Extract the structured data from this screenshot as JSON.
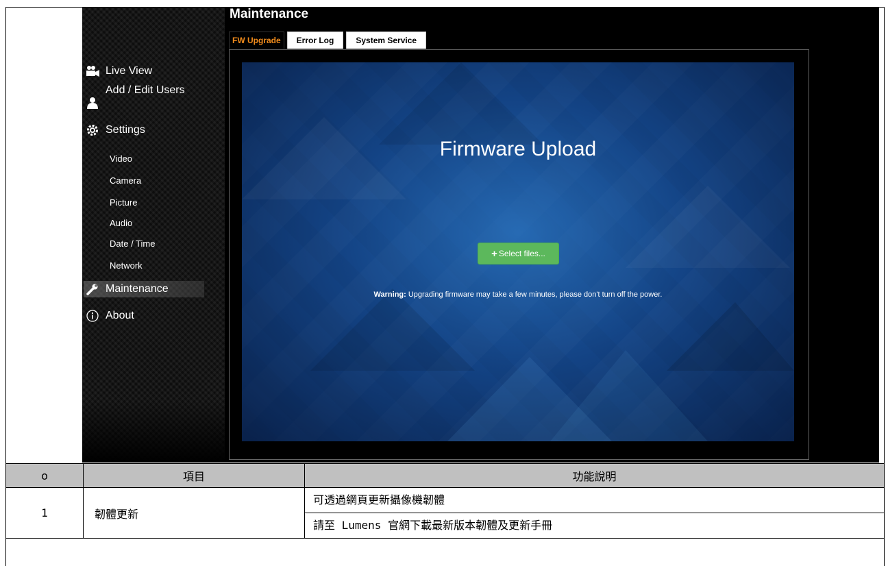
{
  "sidebar": {
    "items": [
      {
        "label": "Live View",
        "icon": "video-camera-icon"
      },
      {
        "label": "Add / Edit Users",
        "icon": "user-icon"
      },
      {
        "label": "Settings",
        "icon": "gear-icon"
      }
    ],
    "settings_children": [
      "Video",
      "Camera",
      "Picture",
      "Audio",
      "Date / Time",
      "Network"
    ],
    "maintenance": {
      "label": "Maintenance",
      "icon": "wrench-icon"
    },
    "about": {
      "label": "About",
      "icon": "info-icon"
    }
  },
  "main": {
    "title": "Maintenance",
    "tabs": [
      {
        "label": "FW Upgrade",
        "active": true
      },
      {
        "label": "Error Log",
        "active": false
      },
      {
        "label": "System Service",
        "active": false
      }
    ],
    "upload": {
      "title": "Firmware Upload",
      "button_label": "Select files...",
      "warning_label": "Warning:",
      "warning_text": " Upgrading firmware may take a few minutes, please don't turn off the power."
    }
  },
  "table": {
    "headers": [
      "o",
      "項目",
      "功能說明"
    ],
    "rows": [
      {
        "no": "1",
        "item": "韌體更新",
        "desc": [
          "可透過網頁更新攝像機韌體",
          "請至 Lumens 官網下載最新版本韌體及更新手冊"
        ]
      }
    ]
  },
  "colors": {
    "accent_tab": "#f28c1c",
    "button_green": "#5cb85c",
    "header_gray": "#c0c0c0"
  }
}
